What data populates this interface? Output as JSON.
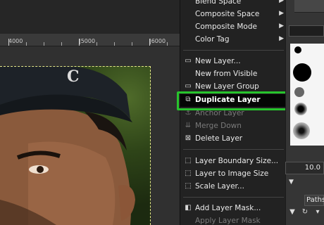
{
  "ruler": {
    "labels": [
      "4000",
      "|5000",
      "|6000"
    ]
  },
  "menu": {
    "items": [
      {
        "label": "Blend Space",
        "icon": "",
        "submenu": true,
        "disabled": false
      },
      {
        "label": "Composite Space",
        "icon": "",
        "submenu": true,
        "disabled": false
      },
      {
        "label": "Composite Mode",
        "icon": "",
        "submenu": true,
        "disabled": false
      },
      {
        "label": "Color Tag",
        "icon": "",
        "submenu": true,
        "disabled": false
      },
      {
        "label": "New Layer...",
        "icon": "new-layer-icon",
        "submenu": false,
        "disabled": false
      },
      {
        "label": "New from Visible",
        "icon": "",
        "submenu": false,
        "disabled": false
      },
      {
        "label": "New Layer Group",
        "icon": "new-group-icon",
        "submenu": false,
        "disabled": false
      },
      {
        "label": "Duplicate Layer",
        "icon": "duplicate-icon",
        "submenu": false,
        "disabled": false,
        "highlighted": true
      },
      {
        "label": "Anchor Layer",
        "icon": "anchor-icon",
        "submenu": false,
        "disabled": true
      },
      {
        "label": "Merge Down",
        "icon": "merge-down-icon",
        "submenu": false,
        "disabled": true
      },
      {
        "label": "Delete Layer",
        "icon": "delete-icon",
        "submenu": false,
        "disabled": false
      },
      {
        "label": "Layer Boundary Size...",
        "icon": "boundary-icon",
        "submenu": false,
        "disabled": false
      },
      {
        "label": "Layer to Image Size",
        "icon": "image-size-icon",
        "submenu": false,
        "disabled": false
      },
      {
        "label": "Scale Layer...",
        "icon": "scale-icon",
        "submenu": false,
        "disabled": false
      },
      {
        "label": "Add Layer Mask...",
        "icon": "mask-icon",
        "submenu": false,
        "disabled": false
      },
      {
        "label": "Apply Layer Mask",
        "icon": "",
        "submenu": false,
        "disabled": true
      }
    ]
  },
  "dock": {
    "opacity_value": "10.0",
    "paths_tab": "Paths"
  },
  "colors": {
    "menu_bg": "#222222",
    "highlight_bg": "#050505",
    "annotation_green": "#27c42c",
    "selection_border": "#e6e88a"
  }
}
